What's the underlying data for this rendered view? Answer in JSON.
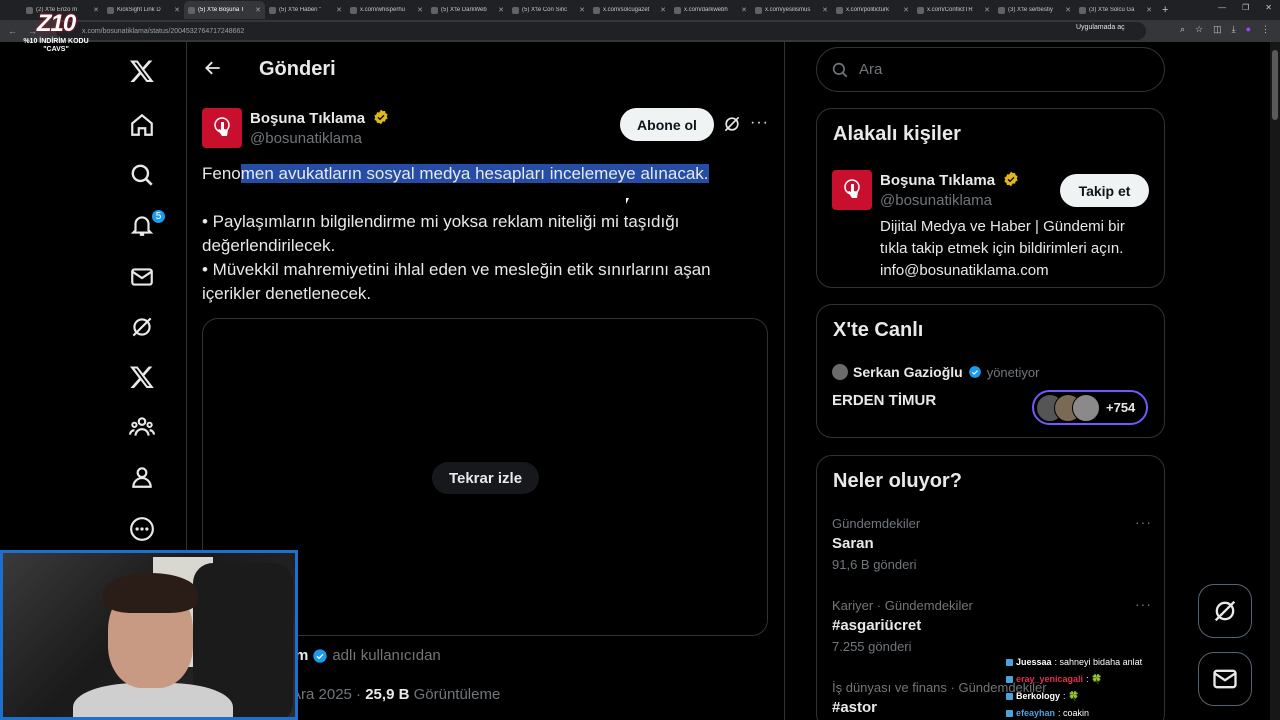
{
  "browser": {
    "tabs": [
      {
        "title": "(2) X'te Enzo m",
        "active": false
      },
      {
        "title": "KickSight Link D",
        "active": false
      },
      {
        "title": "(5) X'te Boşuna T",
        "active": true
      },
      {
        "title": "(5) X'te Haberi \"",
        "active": false
      },
      {
        "title": "x.com/whisperhu",
        "active": false
      },
      {
        "title": "(5) X'te DarkWeb",
        "active": false
      },
      {
        "title": "(5) X'te Con Sinc",
        "active": false
      },
      {
        "title": "x.com/solcugazet",
        "active": false
      },
      {
        "title": "x.com/darkwebh",
        "active": false
      },
      {
        "title": "x.com/yesilismus",
        "active": false
      },
      {
        "title": "x.com/politicturk",
        "active": false
      },
      {
        "title": "x.com/ConflictTR",
        "active": false
      },
      {
        "title": "(3) X'te serbestiy",
        "active": false
      },
      {
        "title": "(3) X'te Solcu Ga",
        "active": false
      }
    ],
    "url": "x.com/bosunatiklama/status/2004532764717248662",
    "open_in_app": "Uygulamada aç"
  },
  "sidebar": {
    "items": [
      {
        "name": "x-logo-icon"
      },
      {
        "name": "home-icon"
      },
      {
        "name": "search-icon"
      },
      {
        "name": "bell-icon",
        "badge": "5"
      },
      {
        "name": "mail-icon"
      },
      {
        "name": "grok-icon"
      },
      {
        "name": "x-premium-icon"
      },
      {
        "name": "communities-icon"
      },
      {
        "name": "profile-icon"
      },
      {
        "name": "more-icon"
      }
    ]
  },
  "header": {
    "title": "Gönderi"
  },
  "post": {
    "author_name": "Boşuna Tıklama",
    "author_handle": "@bosunatiklama",
    "follow_label": "Abone ol",
    "text_line1_pre": "Feno",
    "text_line1_hl": "men avukatların sosyal medya hesapları incelemeye alınacak.",
    "bullet1": "• Paylaşımların bilgilendirme mi yoksa reklam niteliği mi taşıdığı değerlendirilecek.",
    "bullet2": "• Müvekkil mahremiyetini ihlal eden ve mesleğin etik sınırlarını aşan içerikler denetlenecek.",
    "replay_label": "Tekrar izle",
    "from_user_name": "m",
    "from_user_suffix": "adlı kullanıcıdan",
    "date_fragment": "Ara 2025 · ",
    "views_count": "25,9 B",
    "views_label": "Görüntüleme"
  },
  "search": {
    "placeholder": "Ara"
  },
  "related": {
    "title": "Alakalı kişiler",
    "name": "Boşuna Tıklama",
    "handle": "@bosunatiklama",
    "follow_label": "Takip et",
    "bio": "Dijital Medya ve Haber | Gündemi bir tıkla takip etmek için bildirimleri açın. info@bosunatiklama.com"
  },
  "live": {
    "title": "X'te Canlı",
    "host": "Serkan Gazioğlu",
    "host_role": "yönetiyor",
    "space_title": "ERDEN TİMUR",
    "listener_count": "+754"
  },
  "trends": {
    "title": "Neler oluyor?",
    "items": [
      {
        "category": "Gündemdekiler",
        "title": "Saran",
        "count": "91,6 B gönderi"
      },
      {
        "category": "Kariyer · Gündemdekiler",
        "title": "#asgariücret",
        "count": "7.255 gönderi"
      },
      {
        "category": "İş dünyası ve finans · Gündemdekiler",
        "title": "#astor",
        "count": ""
      }
    ]
  },
  "overlay": {
    "logo_text": "Z10",
    "promo_line1": "%10 İNDİRİM KODU",
    "promo_line2": "\"CAVS\"",
    "chat": [
      {
        "user": "Juessaa",
        "message": ": sahneyi bidaha anlat",
        "color": "#ffffff"
      },
      {
        "user": "eray_yenicagali",
        "message": ": 🍀",
        "color": "#e0304f"
      },
      {
        "user": "Berkology",
        "message": ": 🍀",
        "color": "#ffffff"
      },
      {
        "user": "efeayhan",
        "message": ": coakin",
        "color": "#4aa3df"
      }
    ]
  },
  "colors": {
    "accent": "#1d9bf0",
    "brand_red": "#c8102e",
    "highlight": "#264da6",
    "live_border": "#7856ff"
  }
}
